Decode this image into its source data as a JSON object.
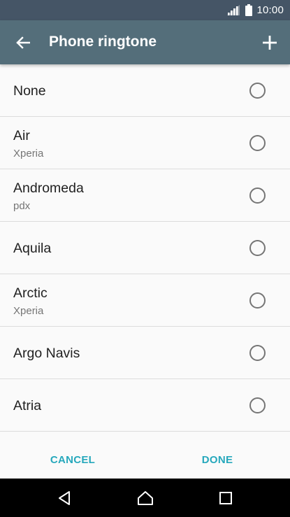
{
  "status_bar": {
    "time": "10:00",
    "icons": [
      "signal-icon",
      "battery-icon"
    ]
  },
  "app_bar": {
    "title": "Phone ringtone",
    "back_icon": "arrow-back-icon",
    "add_icon": "plus-icon",
    "background": "#546e7a"
  },
  "ringtones": [
    {
      "name": "None",
      "subtitle": "",
      "selected": false
    },
    {
      "name": "Air",
      "subtitle": "Xperia",
      "selected": false
    },
    {
      "name": "Andromeda",
      "subtitle": "pdx",
      "selected": false
    },
    {
      "name": "Aquila",
      "subtitle": "",
      "selected": false
    },
    {
      "name": "Arctic",
      "subtitle": "Xperia",
      "selected": false
    },
    {
      "name": "Argo Navis",
      "subtitle": "",
      "selected": false
    },
    {
      "name": "Atria",
      "subtitle": "",
      "selected": false
    }
  ],
  "actions": {
    "cancel_label": "CANCEL",
    "done_label": "DONE",
    "accent": "#26a8bc"
  },
  "nav_bar": {
    "icons": [
      "nav-back-icon",
      "nav-home-icon",
      "nav-recent-icon"
    ]
  }
}
